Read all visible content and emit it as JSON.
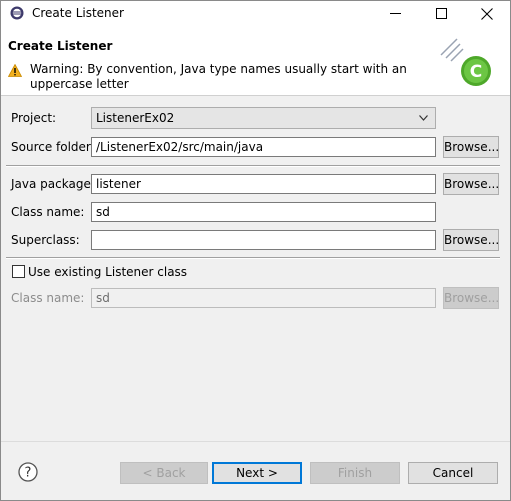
{
  "window": {
    "title": "Create Listener",
    "icon": "eclipse-icon",
    "controls": [
      "minimize-icon",
      "maximize-icon",
      "close-icon"
    ]
  },
  "banner": {
    "title": "Create Listener",
    "warning_icon": "warning-icon",
    "warning": "Warning: By convention, Java type names usually start with an uppercase letter",
    "image_icon": "new-class-wizard-icon"
  },
  "form": {
    "project_label": "Project:",
    "project_value": "ListenerEx02",
    "source_folder_label": "Source folder:",
    "source_folder_value": "/ListenerEx02/src/main/java",
    "java_package_label": "Java package:",
    "java_package_value": "listener",
    "class_name_label": "Class name:",
    "class_name_value": "sd",
    "superclass_label": "Superclass:",
    "superclass_value": "",
    "use_existing_label": "Use existing Listener class",
    "use_existing_checked": false,
    "existing_class_label": "Class name:",
    "existing_class_value": "sd",
    "browse_label": "Browse..."
  },
  "footer": {
    "help_icon": "help-icon",
    "back": "< Back",
    "next": "Next >",
    "finish": "Finish",
    "cancel": "Cancel"
  },
  "colors": {
    "accent": "#0078d7",
    "warning": "#f2b01e",
    "disabled_text": "#8c8c8c"
  }
}
